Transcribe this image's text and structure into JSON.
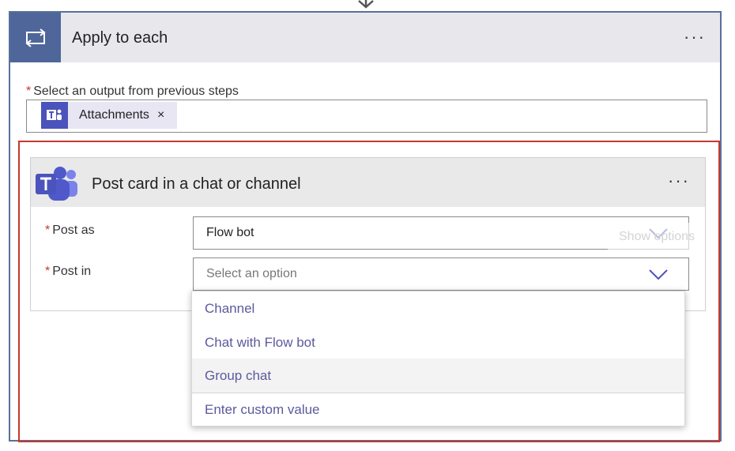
{
  "apply_each": {
    "title": "Apply to each",
    "more": "···",
    "output_label": "Select an output from previous steps",
    "required_mark": "*",
    "token": {
      "label": "Attachments",
      "remove": "×"
    }
  },
  "post_card": {
    "title": "Post card in a chat or channel",
    "more": "···",
    "post_as": {
      "label": "Post as",
      "value": "Flow bot"
    },
    "post_in": {
      "label": "Post in",
      "placeholder": "Select an option"
    },
    "tooltip": "Show options"
  },
  "dropdown": {
    "options": [
      "Channel",
      "Chat with Flow bot",
      "Group chat",
      "Enter custom value"
    ],
    "hovered": "Group chat"
  },
  "colors": {
    "accent": "#4e6699",
    "teams_purple": "#4b53bc",
    "highlight_frame": "#c5382f",
    "option_text": "#5b5a9d"
  }
}
